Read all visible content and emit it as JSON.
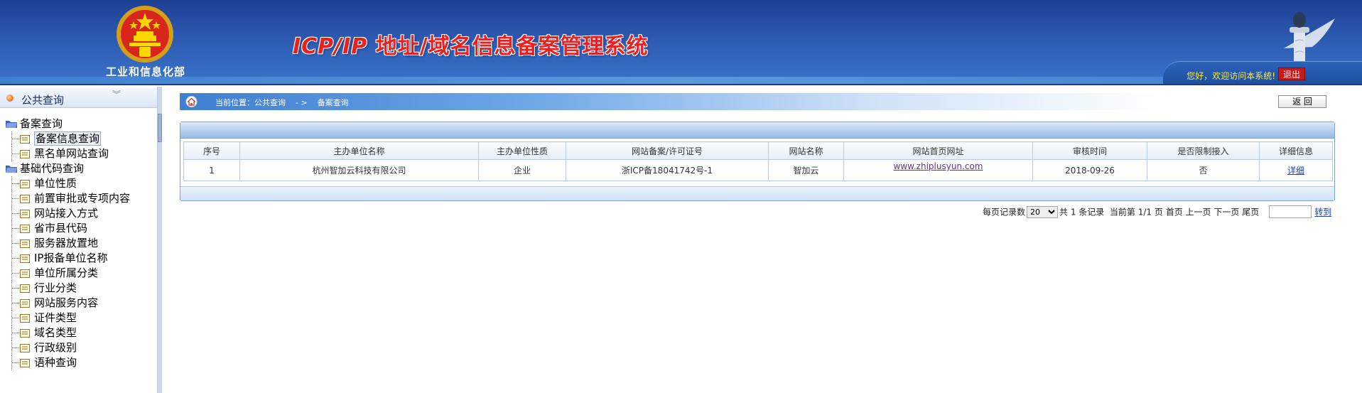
{
  "header": {
    "ministry": "工业和信息化部",
    "title_latin": "ICP/IP",
    "title_cn": " 地址/域名信息备案管理系统",
    "welcome": "您好，欢迎访问本系统!",
    "logout": "退出"
  },
  "sidebar": {
    "title": "公共查询",
    "collapse_glyph": "︾",
    "groups": [
      {
        "label": "备案查询",
        "items": [
          "备案信息查询",
          "黑名单网站查询"
        ]
      },
      {
        "label": "基础代码查询",
        "items": [
          "单位性质",
          "前置审批或专项内容",
          "网站接入方式",
          "省市县代码",
          "服务器放置地",
          "IP报备单位名称",
          "单位所属分类",
          "行业分类",
          "网站服务内容",
          "证件类型",
          "域名类型",
          "行政级别",
          "语种查询"
        ]
      }
    ],
    "selected": "备案信息查询"
  },
  "breadcrumb": {
    "text": "当前位置：公共查询    - >    备案查询"
  },
  "back_button": "返  回",
  "table": {
    "columns": [
      "序号",
      "主办单位名称",
      "主办单位性质",
      "网站备案/许可证号",
      "网站名称",
      "网站首页网址",
      "审核时间",
      "是否限制接入",
      "详细信息"
    ],
    "rows": [
      [
        "1",
        "杭州智加云科技有限公司",
        "企业",
        "浙ICP备18041742号-1",
        "智加云",
        "www.zhiplusyun.com",
        "2018-09-26",
        "否",
        "详细"
      ]
    ]
  },
  "pager": {
    "per_page_label": "每页记录数",
    "per_page_value": "20",
    "total": "共 1 条记录",
    "current": "当前第 1/1 页",
    "first": "首页",
    "prev": "上一页",
    "next": "下一页",
    "last": "尾页",
    "go": "转到"
  },
  "colors": {
    "header_blue": "#2f5fb6",
    "title_red": "#e8201f",
    "welcome_yellow": "#ffe94a",
    "link_blue": "#1f3fbf"
  }
}
